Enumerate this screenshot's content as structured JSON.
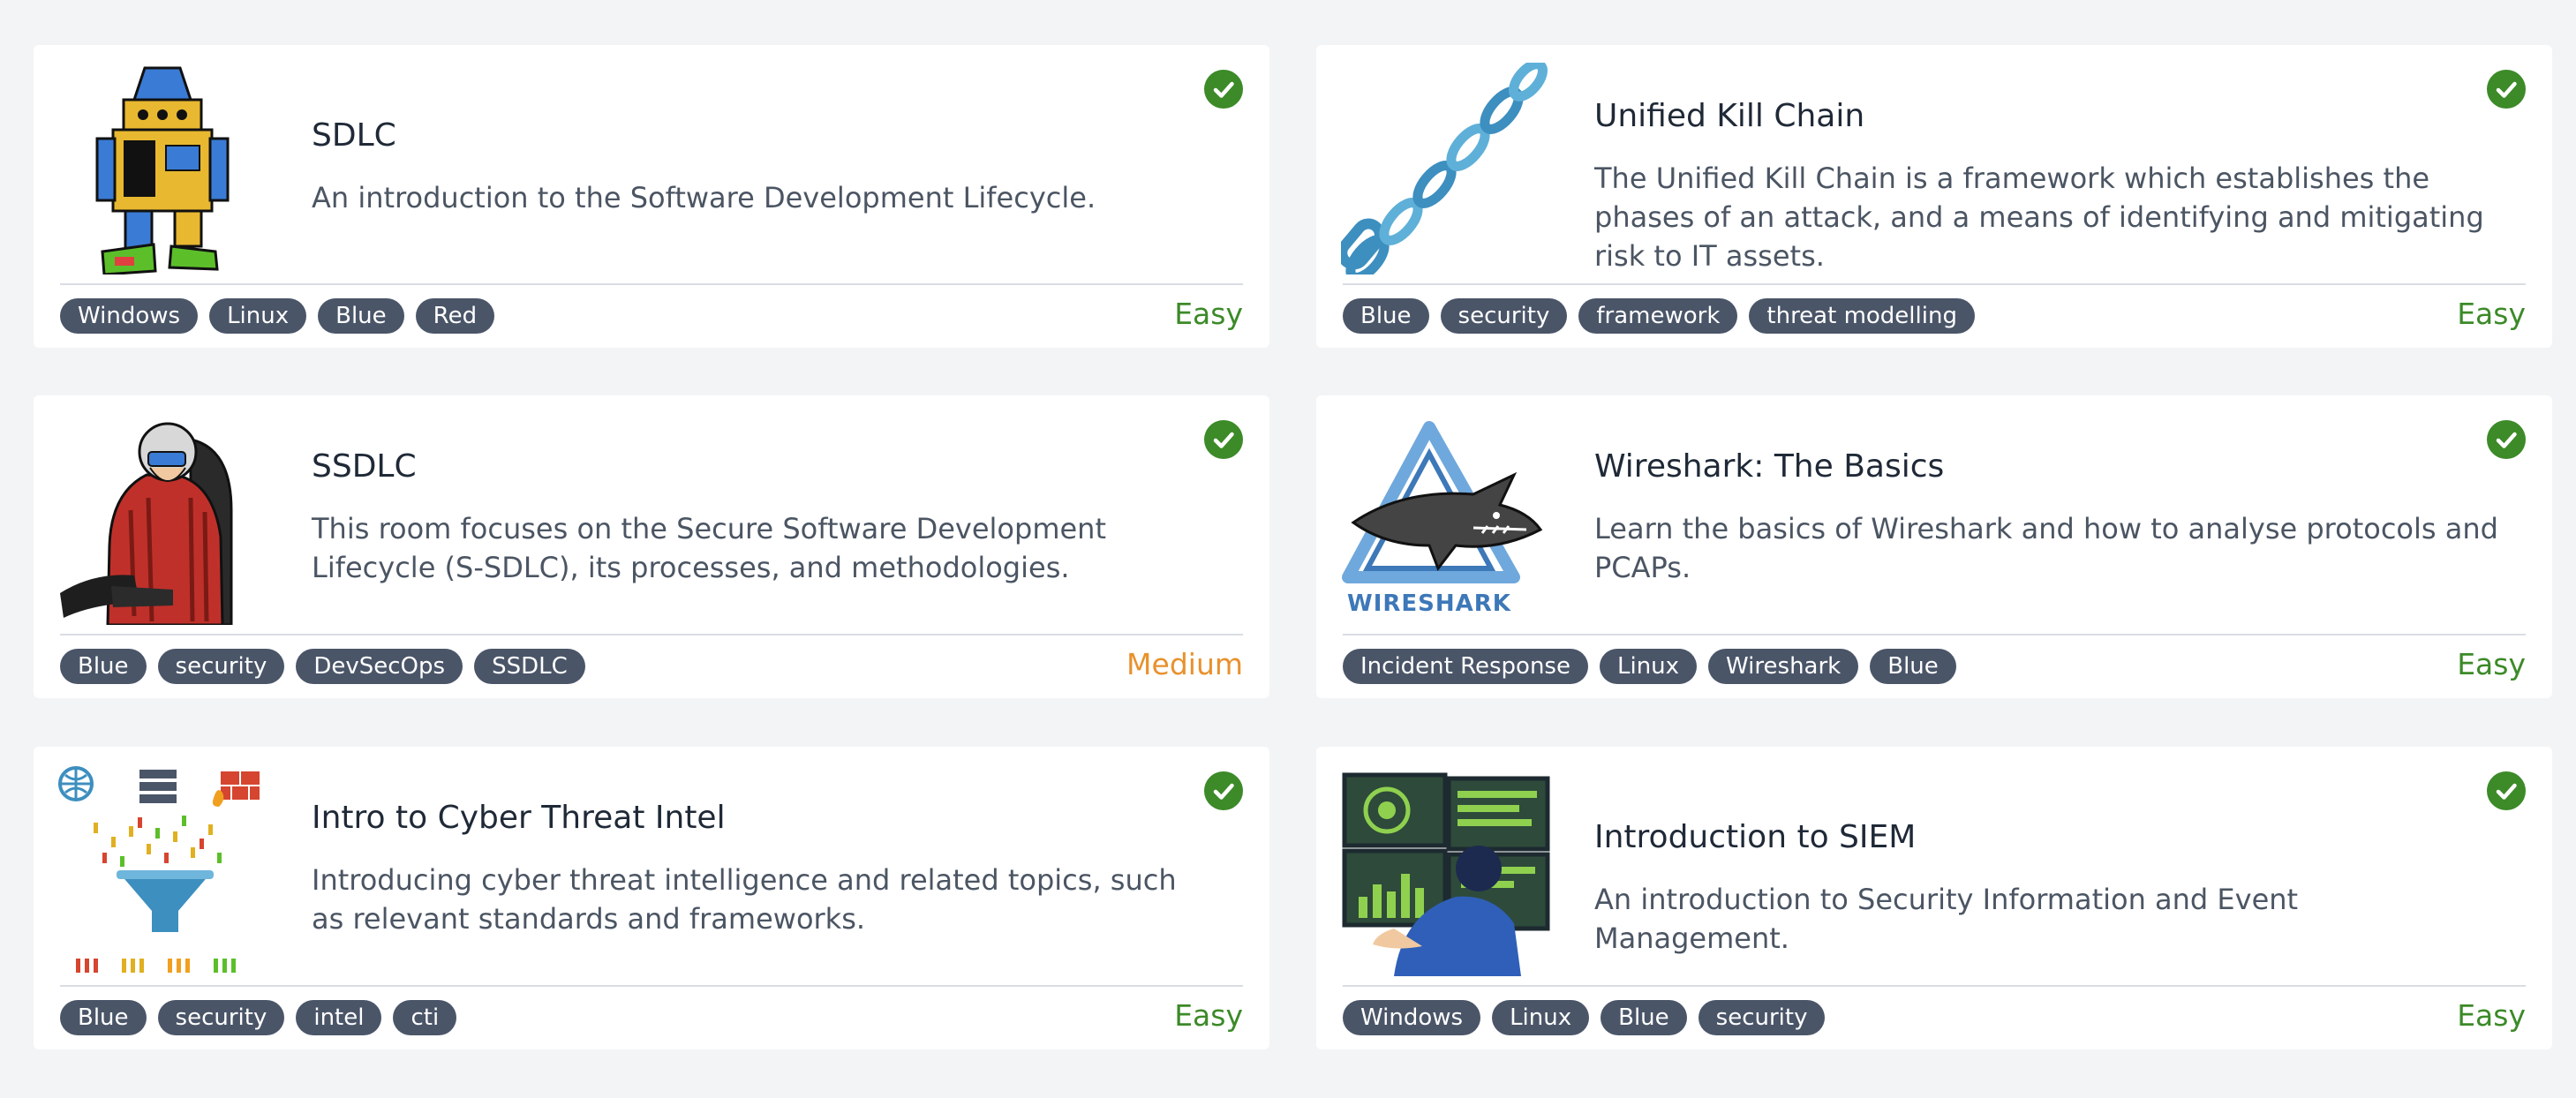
{
  "colors": {
    "page_background": "#f3f4f6",
    "card_background": "#ffffff",
    "tag_background": "#4a5568",
    "check_green": "#3c8a28",
    "easy": "#3c8a28",
    "medium": "#e8912d"
  },
  "rooms": [
    {
      "title": "SDLC",
      "description": "An introduction to the Software Development Lifecycle.",
      "tags": [
        "Windows",
        "Linux",
        "Blue",
        "Red"
      ],
      "difficulty": "Easy",
      "completed": true,
      "image_icon": "robot-icon",
      "status_icon": "check-circle-icon"
    },
    {
      "title": "Unified Kill Chain",
      "description": "The Unified Kill Chain is a framework which establishes the phases of an attack, and a means of identifying and mitigating risk to IT assets.",
      "tags": [
        "Blue",
        "security",
        "framework",
        "threat modelling"
      ],
      "difficulty": "Easy",
      "completed": true,
      "image_icon": "chain-icon",
      "status_icon": "check-circle-icon"
    },
    {
      "title": "SSDLC",
      "description": "This room focuses on the Secure Software Development Lifecycle (S-SDLC), its processes, and methodologies.",
      "tags": [
        "Blue",
        "security",
        "DevSecOps",
        "SSDLC"
      ],
      "difficulty": "Medium",
      "completed": true,
      "image_icon": "pilot-icon",
      "status_icon": "check-circle-icon"
    },
    {
      "title": "Wireshark: The Basics",
      "description": "Learn the basics of Wireshark and how to analyse protocols and PCAPs.",
      "tags": [
        "Incident Response",
        "Linux",
        "Wireshark",
        "Blue"
      ],
      "difficulty": "Easy",
      "completed": true,
      "image_icon": "wireshark-logo-icon",
      "image_text": "WIRESHARK",
      "status_icon": "check-circle-icon"
    },
    {
      "title": "Intro to Cyber Threat Intel",
      "description": "Introducing cyber threat intelligence and related topics, such as relevant standards and frameworks.",
      "tags": [
        "Blue",
        "security",
        "intel",
        "cti"
      ],
      "difficulty": "Easy",
      "completed": true,
      "image_icon": "data-funnel-icon",
      "status_icon": "check-circle-icon"
    },
    {
      "title": "Introduction to SIEM",
      "description": "An introduction to Security Information and Event Management.",
      "tags": [
        "Windows",
        "Linux",
        "Blue",
        "security"
      ],
      "difficulty": "Easy",
      "completed": true,
      "image_icon": "analyst-monitors-icon",
      "status_icon": "check-circle-icon"
    }
  ]
}
